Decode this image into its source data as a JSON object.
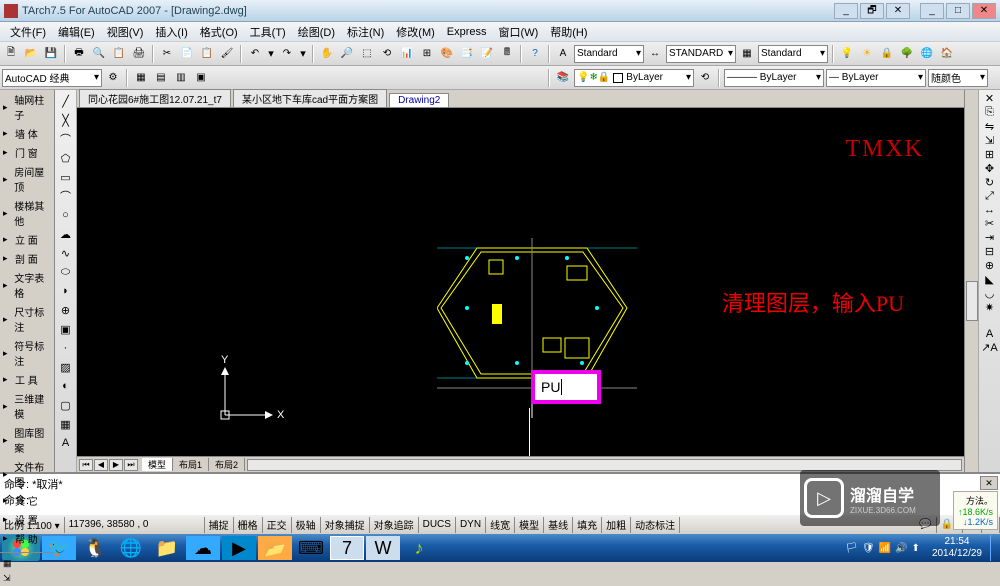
{
  "title": "TArch7.5 For AutoCAD 2007 - [Drawing2.dwg]",
  "menus": [
    "文件(F)",
    "编辑(E)",
    "视图(V)",
    "插入(I)",
    "格式(O)",
    "工具(T)",
    "绘图(D)",
    "标注(N)",
    "修改(M)",
    "Express",
    "窗口(W)",
    "帮助(H)"
  ],
  "workspace": "AutoCAD 经典",
  "styles": {
    "text": "Standard",
    "dim": "STANDARD",
    "table": "Standard"
  },
  "layers": {
    "layer": "ByLayer",
    "linetype": "ByLayer",
    "lineweight": "ByLayer",
    "color": "随颜色"
  },
  "tabs": [
    "同心花园6#施工图12.07.21_t7",
    "某小区地下车库cad平面方案图",
    "Drawing2"
  ],
  "active_tab": 2,
  "tree": [
    "轴网柱子",
    "墙  体",
    "门  窗",
    "房间屋顶",
    "楼梯其他",
    "立  面",
    "剖  面",
    "文字表格",
    "尺寸标注",
    "符号标注",
    "工  具",
    "三维建模",
    "图库图案",
    "文件布图",
    "其  它",
    "设  置",
    "帮  助"
  ],
  "low_tabs": [
    "模型",
    "布局1",
    "布局2"
  ],
  "cmd": {
    "line1": "命令: *取消*",
    "line2": "命令:"
  },
  "input_value": "PU",
  "watermark": "TMXK",
  "annotation": "清理图层，输入PU",
  "status": {
    "scale": "比例 1:100 ▾",
    "coords": "117396, 38580 , 0",
    "toggles": [
      "捕捉",
      "栅格",
      "正交",
      "极轴",
      "对象捕捉",
      "对象追踪",
      "DUCS",
      "DYN",
      "线宽",
      "模型",
      "基线",
      "填充",
      "加粗",
      "动态标注"
    ]
  },
  "extra": {
    "hint": "方法。",
    "s1": "18.6K/s",
    "s2": "1.2K/s"
  },
  "clock": {
    "time": "21:54",
    "date": "2014/12/29"
  },
  "brand": {
    "main": "溜溜自学",
    "sub": "ZIXUE.3D66.COM"
  }
}
